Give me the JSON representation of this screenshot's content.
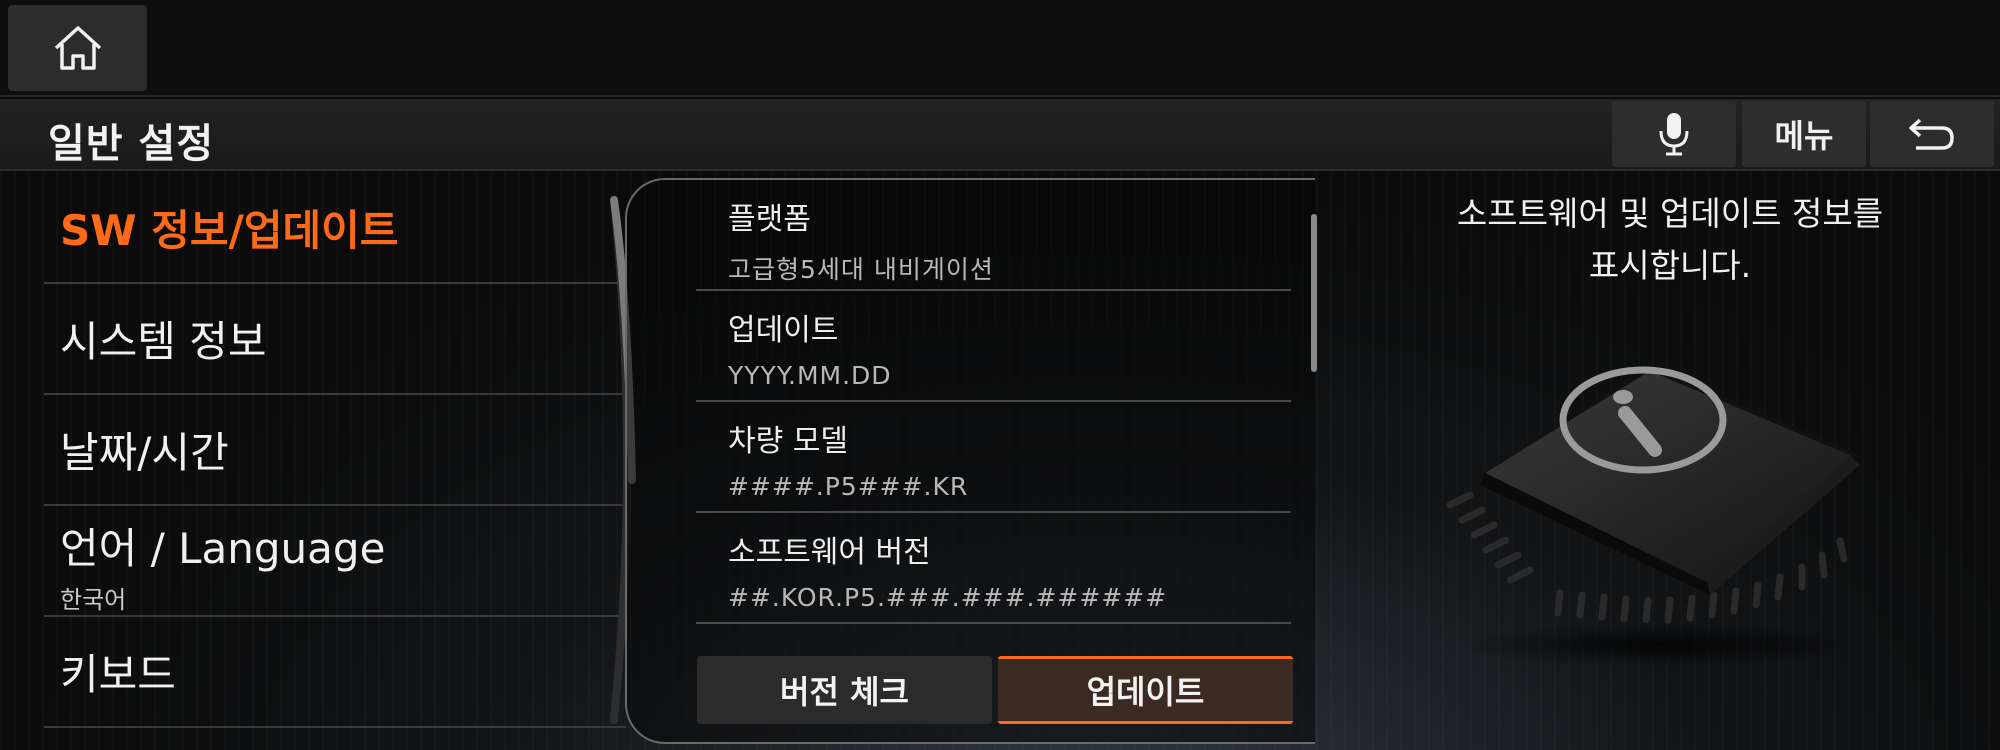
{
  "top_bar": {
    "home_icon": "home-icon"
  },
  "header": {
    "title": "일반 설정",
    "mic_icon": "microphone-icon",
    "menu_label": "메뉴",
    "back_icon": "back-arrow-icon"
  },
  "left_menu": {
    "items": [
      {
        "label": "SW 정보/업데이트",
        "active": true
      },
      {
        "label": "시스템 정보"
      },
      {
        "label": "날짜/시간"
      },
      {
        "label": "언어 / Language",
        "sub": "한국어"
      },
      {
        "label": "키보드"
      }
    ]
  },
  "info": {
    "rows": [
      {
        "label": "플랫폼",
        "value": "고급형5세대 내비게이션"
      },
      {
        "label": "업데이트",
        "value": "YYYY.MM.DD"
      },
      {
        "label": "차량 모델",
        "value": "####.P5###.KR"
      },
      {
        "label": "소프트웨어 버전",
        "value": "##.KOR.P5.###.###.######"
      }
    ],
    "version_check_label": "버전 체크",
    "update_label": "업데이트"
  },
  "description": {
    "line1": "소프트웨어 및 업데이트 정보를",
    "line2": "표시합니다."
  },
  "colors": {
    "accent": "#ff6a17",
    "background": "#0b0b0b",
    "button": "#2b2b2b"
  },
  "chip_icon": "info-chip-icon"
}
